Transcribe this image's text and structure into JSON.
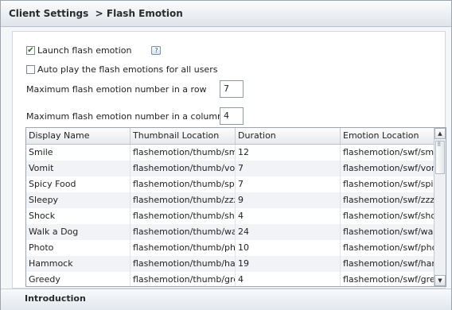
{
  "header": {
    "title": "Client Settings",
    "separator": ">",
    "subtitle": "Flash Emotion"
  },
  "settings": {
    "launch_flash": {
      "label": "Launch flash emotion",
      "checked": true
    },
    "help_icon": "?",
    "auto_play": {
      "label": "Auto play the flash emotions for all users",
      "checked": false
    },
    "max_row": {
      "label": "Maximum flash emotion number in a row",
      "value": "7"
    },
    "max_col": {
      "label": "Maximum flash emotion number in a column",
      "value": "4"
    }
  },
  "table": {
    "columns": [
      "Display Name",
      "Thumbnail Location",
      "Duration",
      "Emotion Location"
    ],
    "rows": [
      [
        "Smile",
        "flashemotion/thumb/smile.",
        "12",
        "flashemotion/swf/smile"
      ],
      [
        "Vomit",
        "flashemotion/thumb/vomit",
        "7",
        "flashemotion/swf/vomit"
      ],
      [
        "Spicy Food",
        "flashemotion/thumb/spicy.",
        "7",
        "flashemotion/swf/spicy"
      ],
      [
        "Sleepy",
        "flashemotion/thumb/zzz.sv",
        "9",
        "flashemotion/swf/zzz.s"
      ],
      [
        "Shock",
        "flashemotion/thumb/shock",
        "4",
        "flashemotion/swf/shock"
      ],
      [
        "Walk a Dog",
        "flashemotion/thumb/walk.s",
        "24",
        "flashemotion/swf/walk."
      ],
      [
        "Photo",
        "flashemotion/thumb/photo",
        "10",
        "flashemotion/swf/photo"
      ],
      [
        "Hammock",
        "flashemotion/thumb/hamm",
        "19",
        "flashemotion/swf/hamm"
      ],
      [
        "Greedy",
        "flashemotion/thumb/greed",
        "4",
        "flashemotion/swf/greed"
      ]
    ]
  },
  "footer": {
    "title": "Introduction"
  },
  "colors": {
    "panel_bg": "#ffffff",
    "frame_bg": "#f4f6f8",
    "check_mark": "#2a6e1e"
  }
}
